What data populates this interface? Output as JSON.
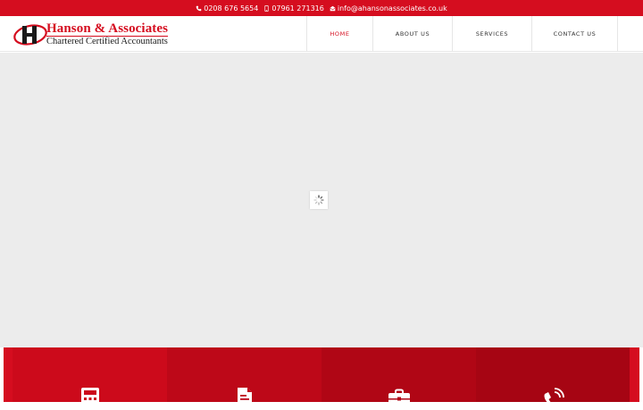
{
  "topbar": {
    "phone": "0208 676 5654",
    "mobile": "07961 271316",
    "email": "info@ahansonassociates.co.uk",
    "icons": [
      "phone-icon",
      "mobile-icon",
      "email-icon"
    ]
  },
  "logo": {
    "name": "Hanson & Associates",
    "tagline": "Chartered Certified Accountants"
  },
  "nav": {
    "items": [
      {
        "label": "HOME",
        "active": true
      },
      {
        "label": "ABOUT US",
        "active": false
      },
      {
        "label": "SERVICES",
        "active": false
      },
      {
        "label": "CONTACT US",
        "active": false
      }
    ]
  },
  "panels": {
    "icons": [
      "calculator-icon",
      "document-icon",
      "briefcase-icon",
      "phone-ringing-icon"
    ]
  },
  "colors": {
    "brand_red": "#d50d1f",
    "hero_bg": "#ececec",
    "panel_1": "#cc0a1b",
    "panel_2": "#bd0818",
    "panel_3": "#b00615",
    "panel_4": "#a60513"
  }
}
